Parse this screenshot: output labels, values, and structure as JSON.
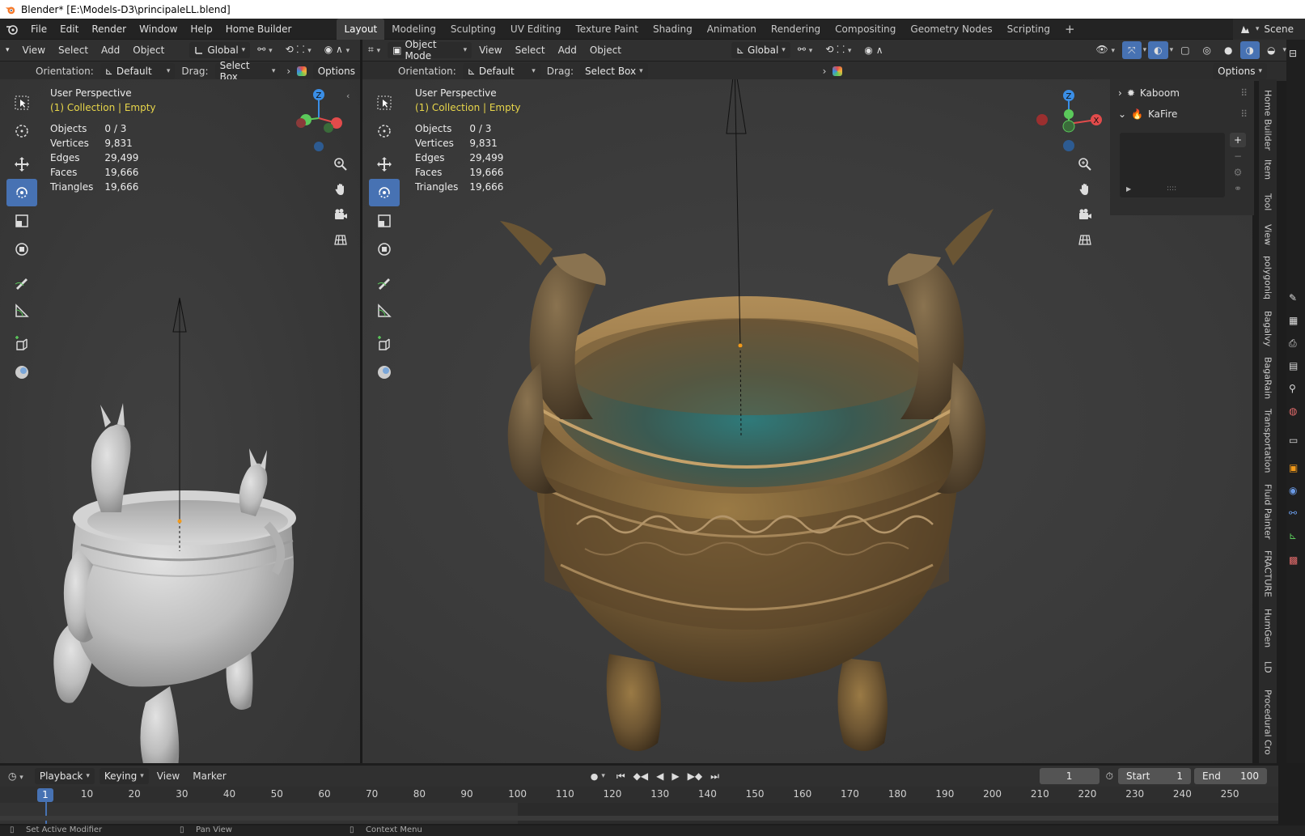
{
  "window": {
    "title": "Blender* [E:\\Models-D3\\principaleLL.blend]"
  },
  "menu": [
    "File",
    "Edit",
    "Render",
    "Window",
    "Help",
    "Home Builder"
  ],
  "workspaces": [
    "Layout",
    "Modeling",
    "Sculpting",
    "UV Editing",
    "Texture Paint",
    "Shading",
    "Animation",
    "Rendering",
    "Compositing",
    "Geometry Nodes",
    "Scripting"
  ],
  "active_workspace": "Layout",
  "scene": "Scene",
  "left_view": {
    "header": {
      "view": "View",
      "select": "Select",
      "add": "Add",
      "object": "Object",
      "transform": "Global"
    },
    "subheader": {
      "orientation_label": "Orientation:",
      "orientation_value": "Default",
      "drag_label": "Drag:",
      "drag_value": "Select Box",
      "options": "Options"
    },
    "overlay": {
      "perspective": "User Perspective",
      "collection": "(1) Collection | Empty"
    },
    "stats": [
      {
        "label": "Objects",
        "value": "0 / 3"
      },
      {
        "label": "Vertices",
        "value": "9,831"
      },
      {
        "label": "Edges",
        "value": "29,499"
      },
      {
        "label": "Faces",
        "value": "19,666"
      },
      {
        "label": "Triangles",
        "value": "19,666"
      }
    ],
    "gizmo_axis": "Z"
  },
  "right_view": {
    "header": {
      "mode": "Object Mode",
      "view": "View",
      "select": "Select",
      "add": "Add",
      "object": "Object",
      "transform": "Global",
      "options": "Options"
    },
    "subheader": {
      "orientation_label": "Orientation:",
      "orientation_value": "Default",
      "drag_label": "Drag:",
      "drag_value": "Select Box"
    },
    "overlay": {
      "perspective": "User Perspective",
      "collection": "(1) Collection | Empty"
    },
    "stats": [
      {
        "label": "Objects",
        "value": "0 / 3"
      },
      {
        "label": "Vertices",
        "value": "9,831"
      },
      {
        "label": "Edges",
        "value": "29,499"
      },
      {
        "label": "Faces",
        "value": "19,666"
      },
      {
        "label": "Triangles",
        "value": "19,666"
      }
    ],
    "gizmo_axes": {
      "z": "Z",
      "x": "X"
    }
  },
  "sidebar": {
    "panels": [
      {
        "label": "Kaboom",
        "expanded": false
      },
      {
        "label": "KaFire",
        "expanded": true
      }
    ],
    "tabs": [
      "Home Builder",
      "Item",
      "Tool",
      "View",
      "polygoniq",
      "Bagalvy",
      "BagaRain",
      "Transportation",
      "Fluid Painter",
      "FRACTURE",
      "HumGen",
      "LD",
      "Procedural Cro"
    ]
  },
  "timeline": {
    "header": {
      "playback": "Playback",
      "keying": "Keying",
      "view": "View",
      "marker": "Marker"
    },
    "current_frame": "1",
    "start_label": "Start",
    "start_value": "1",
    "end_label": "End",
    "end_value": "100",
    "ruler": [
      "10",
      "20",
      "30",
      "40",
      "50",
      "60",
      "70",
      "80",
      "90",
      "100",
      "110",
      "120",
      "130",
      "140",
      "150",
      "160",
      "170",
      "180",
      "190",
      "200",
      "210",
      "220",
      "230",
      "240",
      "250"
    ]
  },
  "statusbar": [
    "Set Active Modifier",
    "Pan View",
    "Context Menu"
  ],
  "colors": {
    "accent": "#4772b3",
    "active_text": "#e8d64a",
    "origin": "#f29a1a"
  }
}
